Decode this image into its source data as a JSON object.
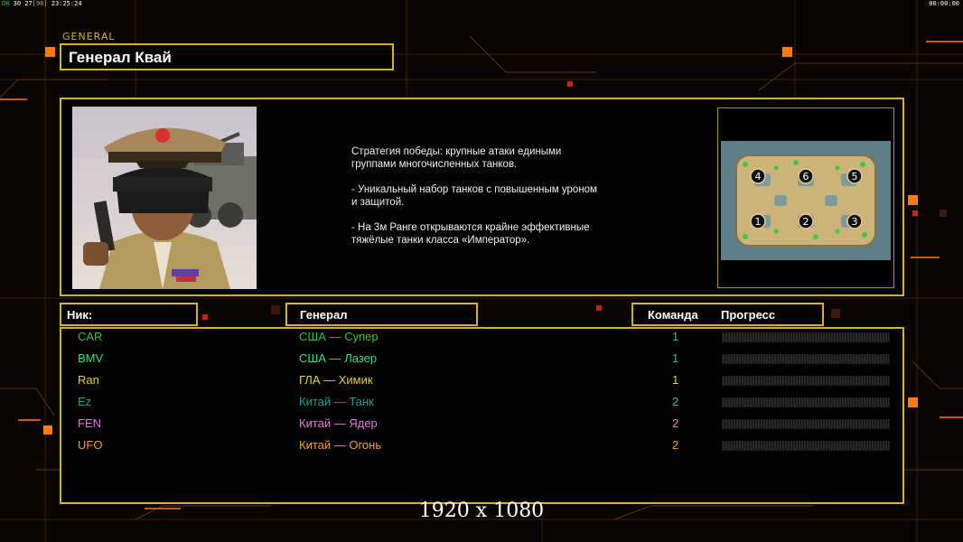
{
  "hud": {
    "left_tag": "DR",
    "left_a": "30",
    "left_b": "27",
    "left_c": "[90]",
    "left_time": "23:25:24",
    "right_time": "00:00:00"
  },
  "panel": {
    "tab_label": "GENERAL",
    "general_name": "Генерал Квай"
  },
  "description": "Стратегия победы: крупные атаки едиными\n группами многочисленных танков.\n\n- Уникальный набор танков с повышенным уроном\n и защитой.\n\n- На 3м Ранге открываются крайне эффективные\n тяжёлые танки класса «Император».",
  "map": {
    "slots": [
      "1",
      "2",
      "3",
      "4",
      "5",
      "6"
    ]
  },
  "table": {
    "nick_header": "Ник:",
    "general_header": "Генерал",
    "team_header": "Команда",
    "progress_header": "Прогресс",
    "players": [
      {
        "nick": "CAR",
        "general": "США — Супер",
        "team": "1",
        "color": "#3fbf3f",
        "team_color": "#2fb8a8",
        "progress": 0
      },
      {
        "nick": "BMV",
        "general": "США — Лазер",
        "team": "1",
        "color": "#35e07a",
        "team_color": "#2fb8a8",
        "progress": 0
      },
      {
        "nick": "Ran",
        "general": "ГЛА — Химик",
        "team": "1",
        "color": "#e6d23a",
        "team_color": "#e6d23a",
        "progress": 0
      },
      {
        "nick": "Ez",
        "general": "Китай — Танк",
        "team": "2",
        "color": "#1f9c9c",
        "team_color": "#2fb8a8",
        "progress": 0
      },
      {
        "nick": "FEN",
        "general": "Китай — Ядер",
        "team": "2",
        "color": "#e07ae0",
        "team_color": "#e07ae0",
        "progress": 0
      },
      {
        "nick": "UFO",
        "general": "Китай — Огонь",
        "team": "2",
        "color": "#f0a030",
        "team_color": "#f0a030",
        "progress": 0
      }
    ]
  },
  "resolution_label": "1920 x 1080",
  "colors": {
    "frame": "#d8b31c",
    "accent_orange": "#ff7a10",
    "background": "#080503"
  }
}
